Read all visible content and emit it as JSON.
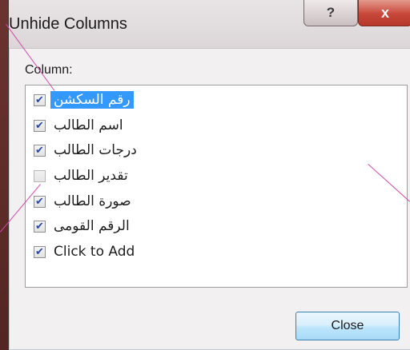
{
  "window": {
    "title": "Unhide Columns",
    "help_glyph": "?",
    "close_glyph": "x"
  },
  "column_label": "Column:",
  "columns": [
    {
      "label": "رقم السكشن",
      "checked": true,
      "selected": true
    },
    {
      "label": "اسم الطالب",
      "checked": true,
      "selected": false
    },
    {
      "label": "درجات الطالب",
      "checked": true,
      "selected": false
    },
    {
      "label": "تقدير الطالب",
      "checked": false,
      "selected": false
    },
    {
      "label": "صورة الطالب",
      "checked": true,
      "selected": false
    },
    {
      "label": "الرقم القومى",
      "checked": true,
      "selected": false
    },
    {
      "label": "Click to Add",
      "checked": true,
      "selected": false
    }
  ],
  "close_button": "Close",
  "colors": {
    "selection": "#3399ff",
    "background": "#5a2a26",
    "pointer_lines": "#d04aa8"
  }
}
